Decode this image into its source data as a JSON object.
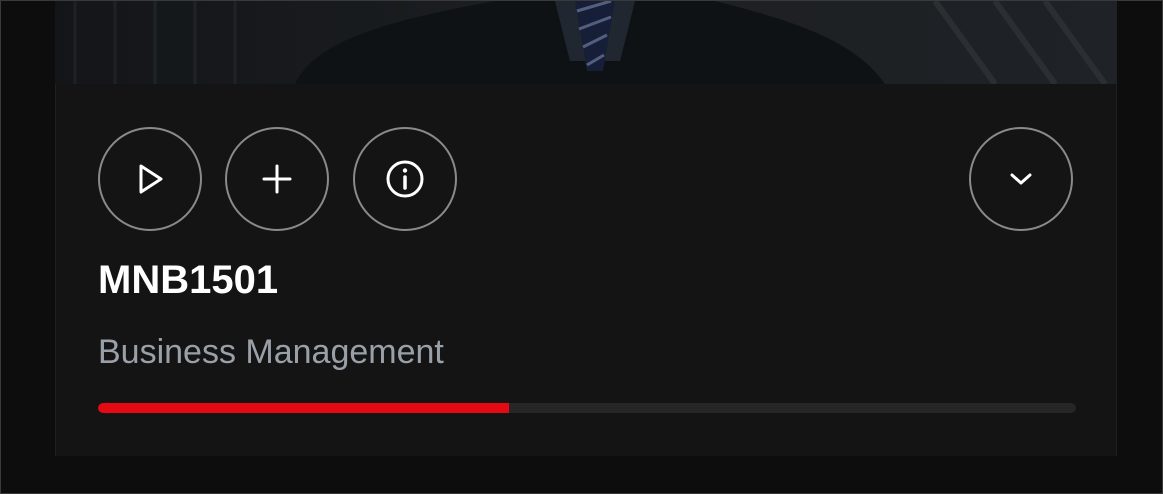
{
  "course": {
    "code": "MNB1501",
    "name": "Business Management",
    "progress_percent": 42
  },
  "actions": {
    "play": {
      "icon": "play-icon"
    },
    "add": {
      "icon": "plus-icon"
    },
    "info": {
      "icon": "info-icon"
    },
    "expand": {
      "icon": "chevron-down-icon"
    }
  },
  "colors": {
    "background": "#141414",
    "progress_fill": "#e50914",
    "progress_track": "#262626",
    "title": "#ffffff",
    "subtitle": "#9aa0a8",
    "button_border": "#8a8a8a"
  }
}
